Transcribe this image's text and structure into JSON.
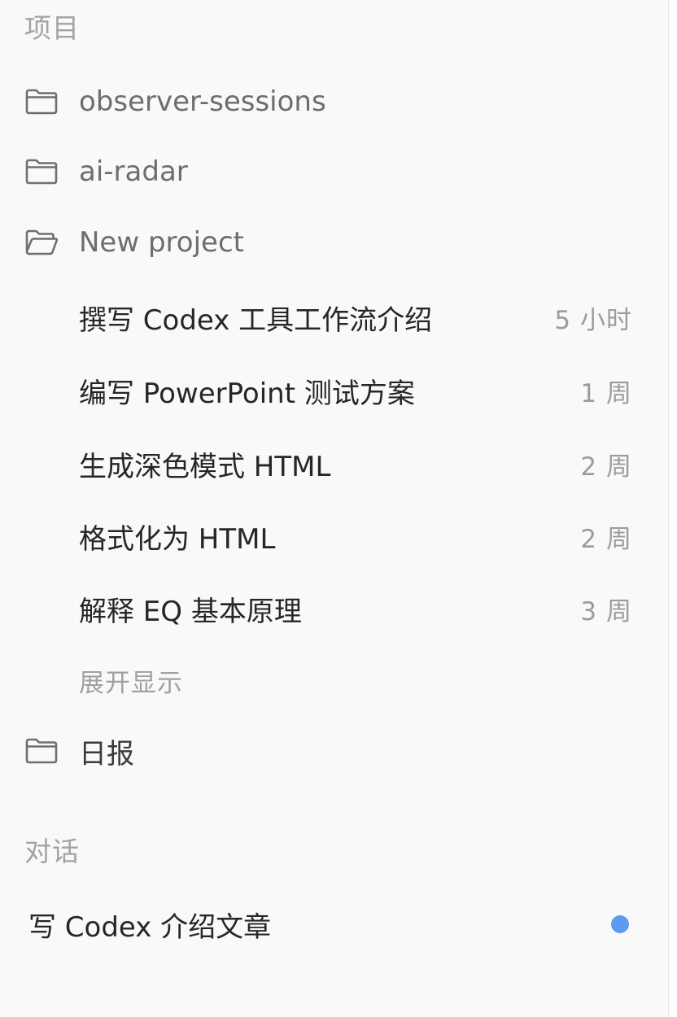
{
  "projects": {
    "title": "项目",
    "folders": [
      {
        "label": "observer-sessions",
        "icon": "folder-icon"
      },
      {
        "label": "ai-radar",
        "icon": "folder-icon"
      },
      {
        "label": "New project",
        "icon": "folder-open-icon"
      }
    ],
    "chats": [
      {
        "title": "撰写 Codex 工具工作流介绍",
        "time": "5 小时"
      },
      {
        "title": "编写 PowerPoint 测试方案",
        "time": "1 周"
      },
      {
        "title": "生成深色模式 HTML",
        "time": "2 周"
      },
      {
        "title": "格式化为 HTML",
        "time": "2 周"
      },
      {
        "title": "解释 EQ 基本原理",
        "time": "3 周"
      }
    ],
    "expand_label": "展开显示",
    "daily_folder": {
      "label": "日报",
      "icon": "folder-icon"
    }
  },
  "conversations": {
    "title": "对话",
    "items": [
      {
        "title": "写 Codex 介绍文章",
        "unread": true,
        "dot_color": "#5b9bf0"
      }
    ]
  }
}
